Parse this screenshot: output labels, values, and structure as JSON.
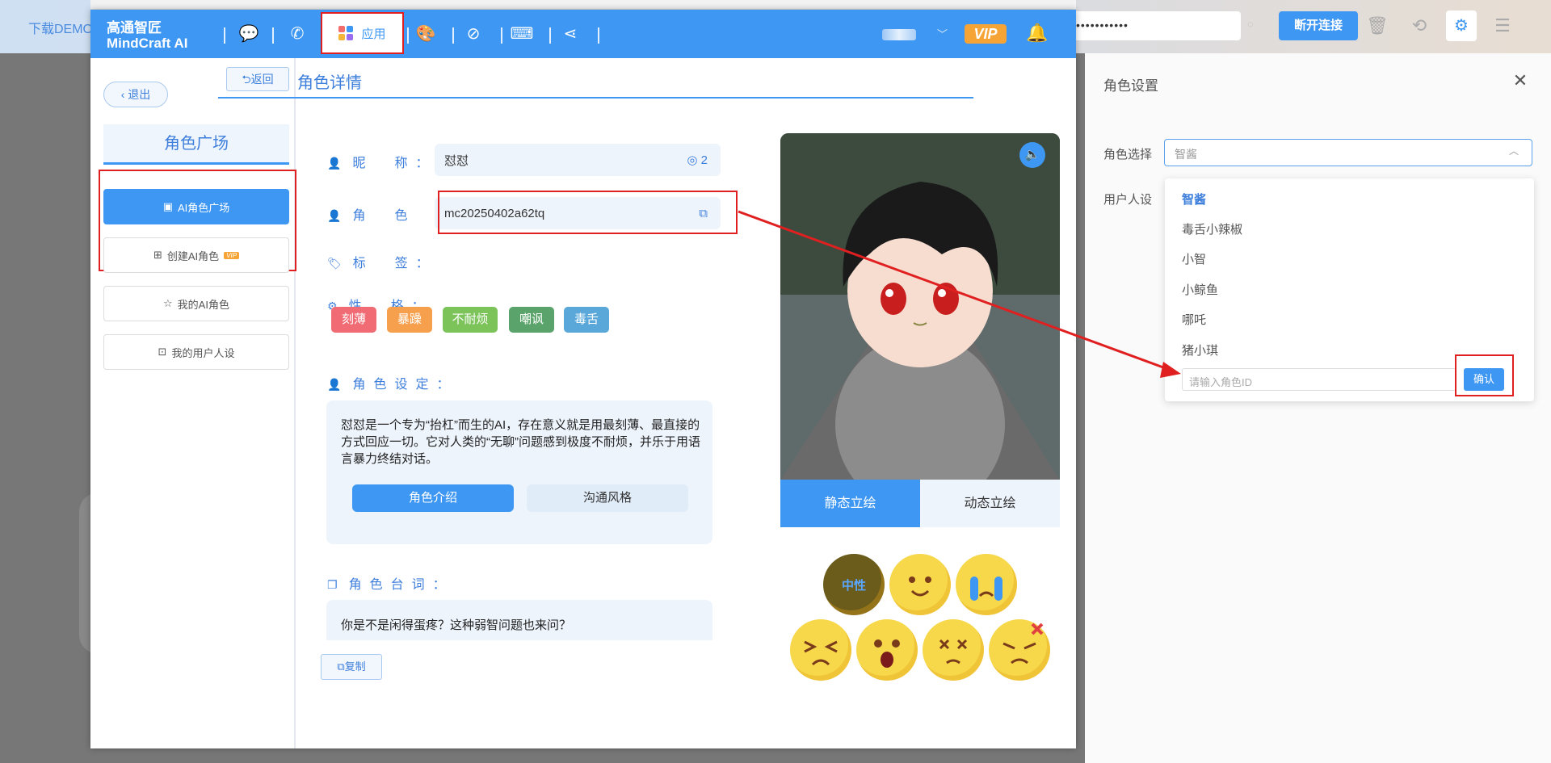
{
  "background_app": {
    "download_link": "下载DEMO",
    "password_mask": "•••••••••••",
    "disconnect_label": "断开连接"
  },
  "header": {
    "logo_line1": "高通智匠",
    "logo_line2": "MindCraft  AI",
    "active_nav_label": "应用",
    "vip_label": "VIP"
  },
  "sidebar": {
    "exit_label": "退出",
    "section_title": "角色广场",
    "items": [
      {
        "label": "AI角色广场",
        "active": true
      },
      {
        "label": "创建AI角色",
        "badge": "VIP"
      },
      {
        "label": "我的AI角色"
      },
      {
        "label": "我的用户人设"
      }
    ]
  },
  "detail": {
    "back_label": "返回",
    "title": "角色详情",
    "nickname_label": "昵　称：",
    "nickname_value": "怼怼",
    "nickname_count": "2",
    "id_label": "角　色　ID：",
    "id_value": "mc20250402a62tq",
    "tags_label": "标　签：",
    "personality_label": "性　格：",
    "personality_tags": [
      {
        "text": "刻薄",
        "color": "#f06b73"
      },
      {
        "text": "暴躁",
        "color": "#f6a04e"
      },
      {
        "text": "不耐烦",
        "color": "#7cc35a"
      },
      {
        "text": "嘲讽",
        "color": "#5aa36a"
      },
      {
        "text": "毒舌",
        "color": "#5aa7d9"
      }
    ],
    "setting_label": "角色设定：",
    "setting_text": "怼怼是一个专为“抬杠”而生的AI，存在意义就是用最刻薄、最直接的方式回应一切。它对人类的“无聊”问题感到极度不耐烦，并乐于用语言暴力终结对话。",
    "tab_intro": "角色介绍",
    "tab_style": "沟通风格",
    "lines_label": "角色台词：",
    "line_text": "你是不是闲得蛋疼？这种弱智问题也来问？",
    "copy_label": "复制"
  },
  "portrait": {
    "tab_static": "静态立绘",
    "tab_dynamic": "动态立绘",
    "emotion_neutral_label": "中性"
  },
  "settings": {
    "title": "角色设置",
    "role_select_label": "角色选择",
    "user_persona_label": "用户人设",
    "select_value": "智酱",
    "options": [
      "智酱",
      "毒舌小辣椒",
      "小智",
      "小鲸鱼",
      "哪吒",
      "猪小琪"
    ],
    "id_input_placeholder": "请输入角色ID",
    "confirm_label": "确认"
  },
  "colors": {
    "accent": "#3e97f2",
    "highlight": "#e02020",
    "vip": "#f7a437"
  }
}
